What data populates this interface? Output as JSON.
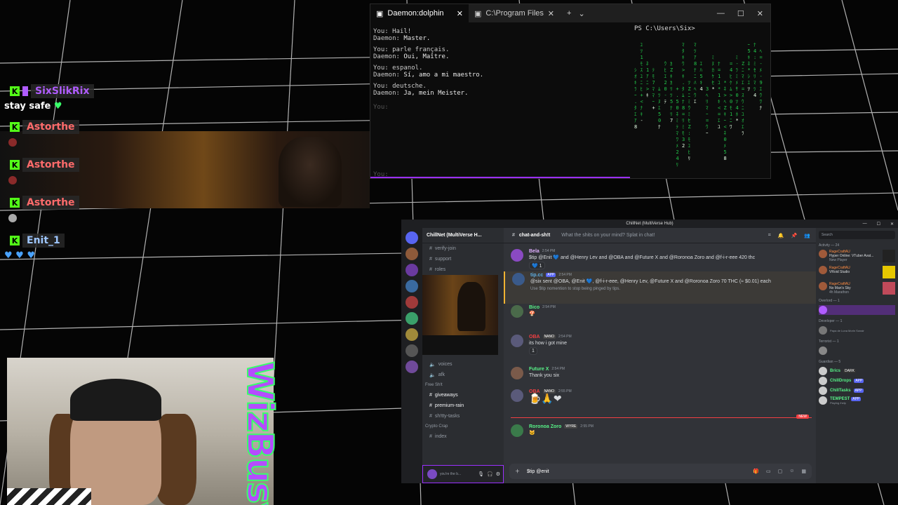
{
  "colors": {
    "kick_green": "#53fc18",
    "purple": "#9b30ff",
    "discord_bg": "#313338",
    "wizbusy_fill": "#b54cff",
    "wizbusy_stroke": "#39ff6a"
  },
  "stream_chat": [
    {
      "user": "SixSlikRix",
      "color": "#b05cff",
      "text": "stay safe",
      "emote": "green-heart-icon"
    },
    {
      "user": "Astorthe",
      "color": "#ff6b6b",
      "text": "",
      "emote": "sticker-icon"
    },
    {
      "user": "Astorthe",
      "color": "#ff6b6b",
      "text": "",
      "emote": "sticker-icon"
    },
    {
      "user": "Astorthe",
      "color": "#ff6b6b",
      "text": "",
      "emote": "sticker-icon"
    },
    {
      "user": "Enit_1",
      "color": "#9ec6ff",
      "text": "",
      "emote": "blue-hearts-icon"
    }
  ],
  "overlay": {
    "wizbusy": "WizBusy"
  },
  "terminal": {
    "tabs": [
      {
        "label": "Daemon:dolphin"
      },
      {
        "label": "C:\\Program Files\\WindowsApp"
      }
    ],
    "new_tab": "+",
    "dropdown": "⌄",
    "lines": [
      {
        "who": "You:",
        "text": "Hail!"
      },
      {
        "who": "Daemon:",
        "text": "Master."
      },
      {
        "who": "You:",
        "text": "parle français."
      },
      {
        "who": "Daemon:",
        "text": "Oui, Maître."
      },
      {
        "who": "You:",
        "text": "espanol."
      },
      {
        "who": "Daemon:",
        "text": "Sí, amo a mi maestro."
      },
      {
        "who": "You:",
        "text": "deutsche."
      },
      {
        "who": "Daemon:",
        "text": "Ja, mein Meister."
      }
    ],
    "prompt1": "You:",
    "prompt2": "You:",
    "ps_prompt": "PS C:\\Users\\Six>"
  },
  "discord": {
    "window_title": "ChillNet (MultiVerse Hub)",
    "server": "ChillNet (MultiVerse H...",
    "channels_top": [
      {
        "name": "verify-join"
      },
      {
        "name": "support"
      },
      {
        "name": "roles"
      }
    ],
    "channels_mid": [
      {
        "name": "voices"
      },
      {
        "name": "afk"
      }
    ],
    "cat_free": "Free Sh!t",
    "channels_free": [
      {
        "name": "giveaways"
      },
      {
        "name": "premium-rain"
      },
      {
        "name": "sh!tty-tasks"
      }
    ],
    "cat_crypto": "Crypto Crap",
    "channels_crypto": [
      {
        "name": "index"
      }
    ],
    "user_panel": "you're the b...",
    "channel": "chat-and-sh!t",
    "topic": "What the shits on your mind? Splat in chat!",
    "messages": [
      {
        "author": "Bela",
        "color": "#e0b0ff",
        "time": "2:54 PM",
        "body": "$tip @Enit 💙 and @Henry Lev and @OBA and @Future X and @Roronoa Zoro and @f-i-r-eee 420 thc",
        "react": "💙 1"
      },
      {
        "author": "tip.cc",
        "color": "#5dade2",
        "time": "2:54 PM",
        "app": "APP",
        "body": "@six sent @OBA, @Enit 💙, @f-i-r-eee, @Henry Lev, @Future X and @Roronoa Zoro 70 THC (≈ $0.01) each",
        "note": "Use $tip nomention to stop being pinged by tips."
      },
      {
        "author": "Bico",
        "color": "#57f287",
        "time": "2:54 PM",
        "body": ""
      },
      {
        "author": "OBA",
        "color": "#f23f42",
        "time": "2:54 PM",
        "tag": "NANO",
        "body": "its how i got mine",
        "react": "1"
      },
      {
        "author": "Future X",
        "color": "#57f287",
        "time": "2:54 PM",
        "body": "Thank you six"
      },
      {
        "author": "OBA",
        "color": "#f23f42",
        "time": "2:55 PM",
        "tag": "NANO",
        "body": ""
      },
      {
        "author": "Roronoa Zoro",
        "color": "#57f287",
        "time": "2:55 PM",
        "tag": "WYRE",
        "body": ""
      }
    ],
    "new_label": "NEW",
    "input_value": "$tip @enit",
    "search_placeholder": "Search",
    "activity_header": "Activity — 24",
    "activities": [
      {
        "name": "RageCraftAU",
        "line1": "Hyper Online: VTuber Avat...",
        "line2": "New Player"
      },
      {
        "name": "RageCraftAU",
        "line1": "VRoid Studio",
        "line2": ""
      },
      {
        "name": "RageCraftAU",
        "line1": "No Man's Sky",
        "line2": "4h Marathon"
      }
    ],
    "overlord_header": "Overlord — 1",
    "developer_header": "Developer — 1",
    "developer_sub": "Papa de Luna Morin Sonair",
    "terrorist_header": "Terrorist — 1",
    "guardian_header": "Guardian — 5",
    "members": [
      {
        "name": "Brics",
        "color": "#57f287",
        "tag": "DARK"
      },
      {
        "name": "ChillDrops",
        "color": "#57f287",
        "tag": "APP"
      },
      {
        "name": "ChillTasks",
        "color": "#57f287",
        "tag": "APP"
      },
      {
        "name": "TEMPEST",
        "color": "#57f287",
        "tag": "APP",
        "sub": "Playing /help"
      }
    ]
  }
}
